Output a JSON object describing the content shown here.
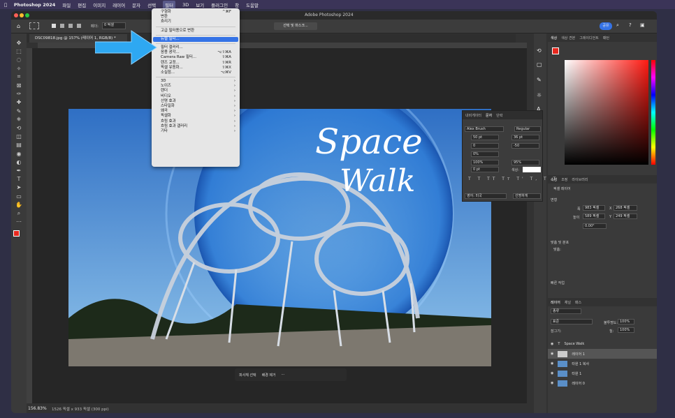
{
  "menubar": {
    "app": "Photoshop 2024",
    "items": [
      "파일",
      "편집",
      "이미지",
      "레이어",
      "문자",
      "선택",
      "필터",
      "3D",
      "보기",
      "플러그인",
      "창",
      "도움말"
    ]
  },
  "title": "Adobe Photoshop 2024",
  "options": {
    "feather_label": "페더:",
    "feather_value": "0 픽셀",
    "select_mask": "선택 및 마스크...",
    "share": "공유"
  },
  "tab": "DSC09818.jpg @ 157% (레이어 1, RGB/8) *",
  "filter_menu": [
    {
      "label": "구형화",
      "sc": "^⌘F"
    },
    {
      "label": "변환"
    },
    {
      "label": "흐리기"
    },
    {
      "sep": true
    },
    {
      "label": "고급 필터용으로 변환"
    },
    {
      "sep": true
    },
    {
      "label": "뉴럴 필터...",
      "hl": true
    },
    {
      "sep": true
    },
    {
      "label": "필터 갤러리..."
    },
    {
      "label": "응용 광각...",
      "sc": "⌥⇧⌘A"
    },
    {
      "label": "Camera Raw 필터...",
      "sc": "⇧⌘A"
    },
    {
      "label": "렌즈 교정...",
      "sc": "⇧⌘R"
    },
    {
      "label": "픽셀 유동화...",
      "sc": "⇧⌘X"
    },
    {
      "label": "소실점...",
      "sc": "⌥⌘V"
    },
    {
      "sep": true
    },
    {
      "label": "3D",
      "ar": true
    },
    {
      "label": "노이즈",
      "ar": true
    },
    {
      "label": "렌더",
      "ar": true
    },
    {
      "label": "비디오",
      "ar": true
    },
    {
      "label": "선명 효과",
      "ar": true
    },
    {
      "label": "스타일화",
      "ar": true
    },
    {
      "label": "왜곡",
      "ar": true
    },
    {
      "label": "픽셀화",
      "ar": true
    },
    {
      "label": "흐림 효과",
      "ar": true
    },
    {
      "label": "흐림 효과 갤러리",
      "ar": true
    },
    {
      "label": "기타",
      "ar": true
    }
  ],
  "artwork": {
    "line1": "Space",
    "line2": "Walk"
  },
  "character": {
    "tabs": [
      "내비게이터",
      "문자",
      "단락"
    ],
    "font": "Alex Brush",
    "style": "Regular",
    "size": "50 pt",
    "leading": "36 pt",
    "kerning": "0",
    "tracking": "-50",
    "scale_v": "0%",
    "scale_h": "100%",
    "scale_h2": "95%",
    "baseline": "0 pt",
    "color_label": "색상:",
    "lang": "영어: 미국",
    "aa": "선명하게"
  },
  "color_panel": {
    "tabs": [
      "색상",
      "색상 견본",
      "그레이디언트",
      "패턴"
    ]
  },
  "properties": {
    "tabs": [
      "속성",
      "조정",
      "라이브러리"
    ],
    "layer_type": "픽셀 레이어",
    "transform": "변형",
    "w_label": "폭",
    "w": "983 픽셀",
    "h_label": "높이",
    "h": "589 픽셀",
    "x_label": "X",
    "x": "268 픽셀",
    "y_label": "Y",
    "y": "249 픽셀",
    "angle": "0.00°",
    "align": "맞춤 및 분포",
    "align_label": "맞춤:",
    "quick": "빠른 작업"
  },
  "layers": {
    "tabs": [
      "레이어",
      "채널",
      "패스"
    ],
    "filter": "종류",
    "blend": "표준",
    "opacity_label": "불투명도:",
    "opacity": "100%",
    "lock_label": "잠그기:",
    "fill_label": "칠:",
    "fill": "100%",
    "items": [
      "Space      Walk",
      "레이어 1",
      "타원 1 복사",
      "타원 1",
      "레이어 0"
    ],
    "text_icon": "T"
  },
  "context_bar": {
    "select": "피사체 선택",
    "remove": "배경 제거"
  },
  "status": {
    "zoom": "156.83%",
    "info": "1526 픽셀 x 933 픽셀 (300 ppi)"
  },
  "colors": {
    "accent": "#3573e6",
    "fg": "#e8281e"
  }
}
